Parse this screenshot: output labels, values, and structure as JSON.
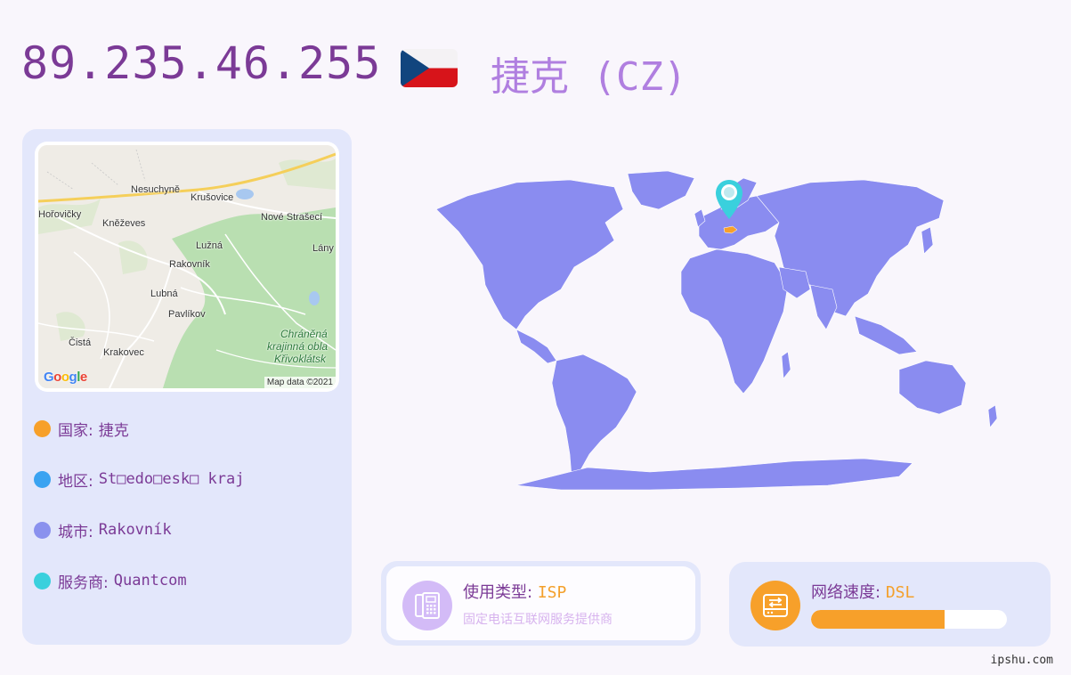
{
  "header": {
    "ip": "89.235.46.255",
    "country_title": "捷克 (CZ)",
    "flag_icon": "czech-flag-icon"
  },
  "map": {
    "labels": {
      "nesuchyne": "Nesuchyně",
      "krusovice": "Krušovice",
      "horovicky": "Hořovičky",
      "knezeves": "Kněževes",
      "nove_straseci": "Nové Strašecí",
      "luzna": "Lužná",
      "lany": "Lány",
      "rakovnik": "Rakovník",
      "lubna": "Lubná",
      "pavlikov": "Pavlíkov",
      "cista": "Čistá",
      "krakovec": "Krakovec",
      "park_line1": "Chráněná",
      "park_line2": "krajinná obla",
      "park_line3": "Křivoklátsk"
    },
    "google": "Google",
    "credit": "Map data ©2021"
  },
  "info": {
    "country": {
      "label": "国家:",
      "value": "捷克",
      "color": "#f7a02a"
    },
    "region": {
      "label": "地区:",
      "value": "St□edo□esk□ kraj",
      "color": "#3aa3f1"
    },
    "city": {
      "label": "城市:",
      "value": "Rakovník",
      "color": "#8a91ee"
    },
    "isp": {
      "label": "服务商:",
      "value": "Quantcom",
      "color": "#3ad0dd"
    }
  },
  "usage": {
    "title": "使用类型:",
    "value": "ISP",
    "subtitle": "固定电话互联网服务提供商",
    "icon": "telephone-icon",
    "icon_color": "#d3bbf7"
  },
  "speed": {
    "title": "网络速度:",
    "value": "DSL",
    "icon": "hard-drive-icon",
    "icon_color": "#f7a02a",
    "level_percent": 68
  },
  "colors": {
    "ip": "#7b3a96",
    "country": "#b07fe0",
    "world_land": "#8a8cf0",
    "highlight": "#f7a02a",
    "pin": "#3ad0dd"
  },
  "watermark": "ipshu.com"
}
